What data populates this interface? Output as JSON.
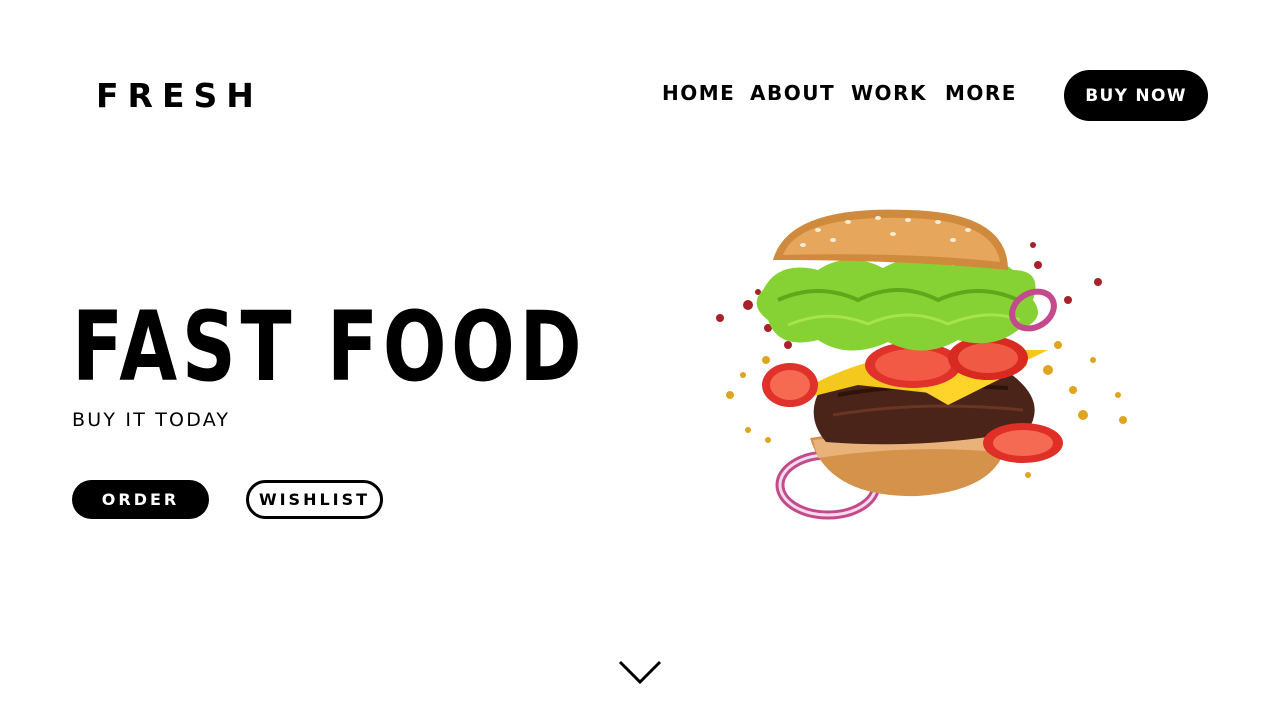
{
  "header": {
    "logo": "FRESH",
    "nav": [
      {
        "label": "HOME"
      },
      {
        "label": "ABOUT"
      },
      {
        "label": "WORK"
      },
      {
        "label": "MORE"
      }
    ],
    "cta_label": "BUY NOW"
  },
  "hero": {
    "title": "FAST FOOD",
    "subtitle": "BUY IT TODAY",
    "order_label": "ORDER",
    "wishlist_label": "WISHLIST",
    "image": "burger-illustration"
  },
  "scroll_indicator_icon": "chevron-down-icon",
  "colors": {
    "background": "#ffffff",
    "text": "#000000",
    "button": "#000000",
    "button_text": "#ffffff"
  }
}
